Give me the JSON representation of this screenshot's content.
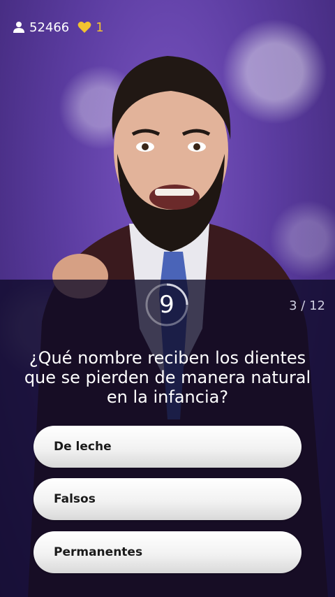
{
  "topbar": {
    "players_icon": "person-icon",
    "players_count": "52466",
    "lives_icon": "heart-icon",
    "lives_count": "1",
    "lives_color": "#f2c230"
  },
  "timer": {
    "seconds": "9"
  },
  "progress": {
    "label": "3 / 12"
  },
  "question": {
    "text": "¿Qué nombre reciben los dientes que se pierden de manera natural en la infancia?"
  },
  "answers": [
    {
      "label": "De leche"
    },
    {
      "label": "Falsos"
    },
    {
      "label": "Permanentes"
    }
  ]
}
